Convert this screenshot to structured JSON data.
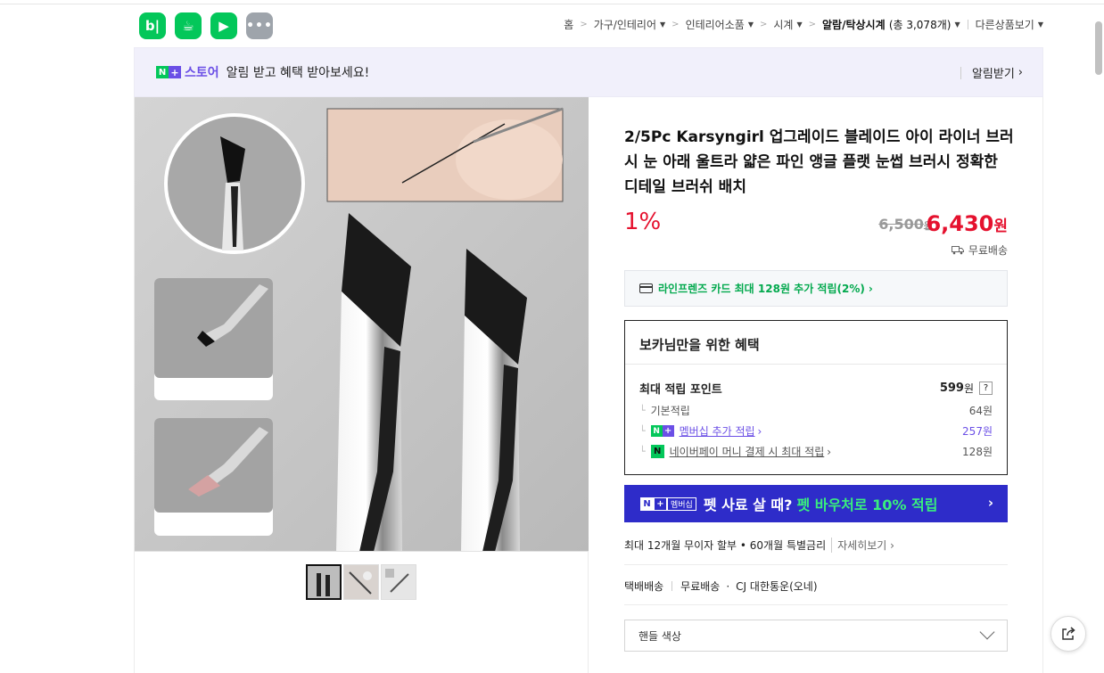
{
  "apps": [
    {
      "name": "blog-app-icon",
      "glyph": "b|"
    },
    {
      "name": "cafe-app-icon",
      "glyph": "☕"
    },
    {
      "name": "naver-app-icon",
      "glyph": "▶"
    },
    {
      "name": "more-apps-icon",
      "glyph": "•••"
    }
  ],
  "breadcrumb": {
    "home": "홈",
    "level1": "가구/인테리어",
    "level2": "인테리어소품",
    "level3": "시계",
    "level4": "알람/탁상시계",
    "count": "(총 3,078개)",
    "other": "다른상품보기"
  },
  "banner": {
    "n": "N",
    "plus": "+",
    "store": "스토어",
    "text": "알림 받고 혜택 받아보세요!",
    "action": "알림받기"
  },
  "product": {
    "title": "2/5Pc Karsyngirl 업그레이드 블레이드 아이 라이너 브러시 눈 아래 울트라 얇은 파인 앵글 플랫 눈썹 브러시 정확한 디테일 브러쉬 배치",
    "discount": "1%",
    "original_price": "6,500",
    "original_unit": "원",
    "sale_price": "6,430",
    "sale_unit": "원",
    "shipping": "무료배송"
  },
  "card_offer": "라인프렌즈 카드 최대 128원 추가 적립(2%)",
  "benefits": {
    "title": "보카님만을 위한 혜택",
    "max_label": "최대 적립 포인트",
    "max_value": "599",
    "max_unit": "원",
    "help": "?",
    "rows": [
      {
        "label": "기본적립",
        "value": "64원"
      },
      {
        "label": "멤버십 추가 적립",
        "value": "257원"
      },
      {
        "label": "네이버페이 머니 결제 시 최대 적립",
        "value": "128원"
      }
    ]
  },
  "pet_banner": {
    "tag": "멤버십",
    "text": "펫 사료 살 때?",
    "highlight": "펫 바우처로 10% 적립"
  },
  "installment": {
    "text": "최대 12개월 무이자 할부 • 60개월 특별금리",
    "detail": "자세히보기"
  },
  "delivery": {
    "type": "택배배송",
    "fee": "무료배송",
    "carrier": "CJ 대한통운(오네)"
  },
  "option_select": {
    "label": "핸들 색상"
  },
  "colors": {
    "naver_green": "#03c75a",
    "store_purple": "#6b4fe6",
    "price_red": "#e5112e",
    "pet_blue": "#2e2cc9"
  }
}
